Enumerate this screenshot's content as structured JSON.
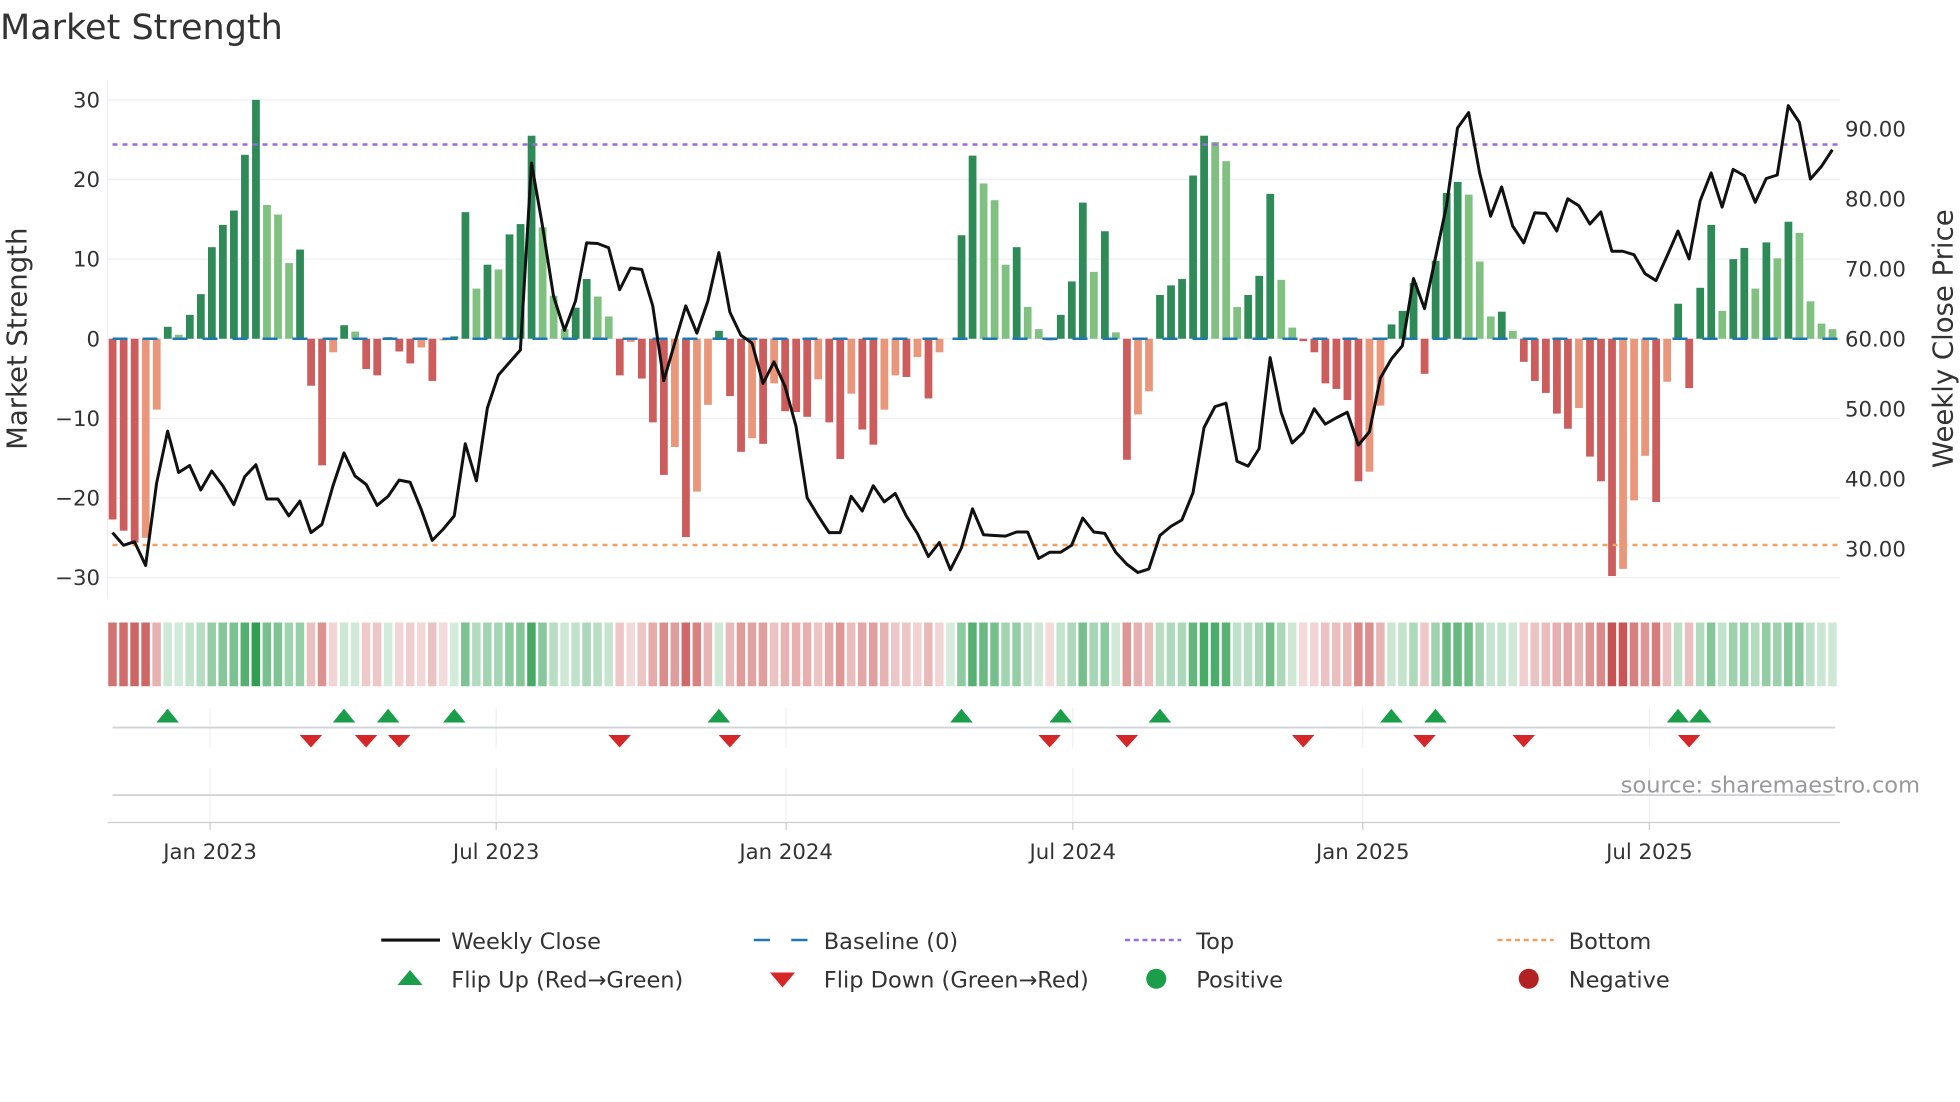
{
  "chart_data": {
    "type": "bar",
    "title": "Market Strength",
    "ylabel": "Market Strength",
    "y2label": "Weekly Close Price",
    "ylim": [
      -32,
      32
    ],
    "y2lim": [
      24,
      96
    ],
    "yticks": [
      -30,
      -20,
      -10,
      0,
      10,
      20,
      30
    ],
    "yticklabels": [
      "−30",
      "−20",
      "−10",
      "0",
      "10",
      "20",
      "30"
    ],
    "y2ticks": [
      30,
      40,
      50,
      60,
      70,
      80,
      90
    ],
    "y2ticklabels": [
      "30.00",
      "40.00",
      "50.00",
      "60.00",
      "70.00",
      "80.00",
      "90.00"
    ],
    "xticks": [
      {
        "week": 8.85,
        "label": "Jan 2023"
      },
      {
        "week": 34.8,
        "label": "Jul 2023"
      },
      {
        "week": 61.1,
        "label": "Jan 2024"
      },
      {
        "week": 87.1,
        "label": "Jul 2024"
      },
      {
        "week": 113.4,
        "label": "Jan 2025"
      },
      {
        "week": 139.4,
        "label": "Jul 2025"
      }
    ],
    "grid": true,
    "top_level": 24.4,
    "bottom_level": -25.9,
    "baseline": 0,
    "strength": [
      -22.7,
      -24.1,
      -25.6,
      -25,
      -8.9,
      1.5,
      0.5,
      3.0,
      5.6,
      11.5,
      14.3,
      16.1,
      23.1,
      30.0,
      16.8,
      15.6,
      9.5,
      11.2,
      -5.9,
      -15.9,
      -1.7,
      1.7,
      0.9,
      -3.8,
      -4.6,
      0.2,
      -1.6,
      -3.1,
      -1.1,
      -5.3,
      -0.2,
      0.3,
      15.9,
      6.3,
      9.3,
      8.7,
      13.1,
      14.4,
      25.5,
      14.0,
      5.4,
      1.2,
      3.9,
      7.5,
      5.3,
      2.8,
      -4.6,
      -0.4,
      -5.0,
      -10.5,
      -17.1,
      -13.6,
      -24.9,
      -19.2,
      -8.3,
      1.0,
      -7.2,
      -14.2,
      -12.5,
      -13.2,
      -5.6,
      -9.1,
      -9.2,
      -9.8,
      -5.1,
      -10.5,
      -15.1,
      -6.9,
      -11.4,
      -13.3,
      -8.9,
      -4.6,
      -4.8,
      -2.3,
      -7.5,
      -1.7,
      0,
      13.0,
      23.0,
      19.5,
      17.4,
      9.3,
      11.5,
      4.0,
      1.2,
      -0.2,
      3.0,
      7.2,
      17.1,
      8.4,
      13.5,
      0.8,
      -15.2,
      -9.5,
      -6.6,
      5.5,
      6.7,
      7.5,
      20.5,
      25.5,
      24.7,
      22.3,
      4.0,
      5.5,
      7.9,
      18.2,
      7.4,
      1.4,
      -0.3,
      -1.7,
      -5.6,
      -6.3,
      -7.7,
      -17.9,
      -16.7,
      -8.4,
      1.8,
      3.5,
      7.0,
      -4.4,
      9.8,
      18.3,
      19.7,
      18.1,
      9.7,
      2.8,
      3.4,
      1.0,
      -2.9,
      -5.3,
      -6.8,
      -9.4,
      -11.3,
      -8.7,
      -14.8,
      -17.9,
      -29.8,
      -28.9,
      -20.3,
      -14.7,
      -20.5,
      -5.4,
      4.4,
      -6.2,
      6.4,
      14.3,
      3.5,
      10.0,
      11.4,
      6.3,
      12.1,
      10.1,
      14.7,
      13.3,
      4.7,
      1.9,
      1.2
    ],
    "weekly_close": [
      32.3,
      30.5,
      31.0,
      27.6,
      39.4,
      46.8,
      40.9,
      41.9,
      38.4,
      41.1,
      39.0,
      36.3,
      40.3,
      42.0,
      37.1,
      37.1,
      34.7,
      36.8,
      32.3,
      33.5,
      39.0,
      43.7,
      40.4,
      39.2,
      36.2,
      37.5,
      39.8,
      39.5,
      35.6,
      31.2,
      32.8,
      34.7,
      45.0,
      39.7,
      50.1,
      54.8,
      56.6,
      58.4,
      85.1,
      76.1,
      66.1,
      61.2,
      65.4,
      73.7,
      73.6,
      73.0,
      67.0,
      70.1,
      69.9,
      64.7,
      54.0,
      59.4,
      64.7,
      60.8,
      65.4,
      72.3,
      63.8,
      60.5,
      59.4,
      53.6,
      56.7,
      53.2,
      47.5,
      37.3,
      34.7,
      32.3,
      32.3,
      37.5,
      35.4,
      39.0,
      36.7,
      37.9,
      34.7,
      32.2,
      28.9,
      30.9,
      27.0,
      30.1,
      35.7,
      32.0,
      31.9,
      31.8,
      32.4,
      32.4,
      28.6,
      29.5,
      29.5,
      30.5,
      34.4,
      32.4,
      32.2,
      29.5,
      27.8,
      26.6,
      27.1,
      31.9,
      33.2,
      34.1,
      38.0,
      47.3,
      50.3,
      50.8,
      42.5,
      41.8,
      44.3,
      57.3,
      49.5,
      45.1,
      46.6,
      50.0,
      47.8,
      48.7,
      49.5,
      44.8,
      46.7,
      54.4,
      57.1,
      59.0,
      68.6,
      64.3,
      71.6,
      79.0,
      90.1,
      92.3,
      83.7,
      77.5,
      81.7,
      76.1,
      73.7,
      78.0,
      77.9,
      75.4,
      80.0,
      79.0,
      76.4,
      78.1,
      72.5,
      72.5,
      72.0,
      69.3,
      68.3,
      71.8,
      75.4,
      71.4,
      79.7,
      83.7,
      78.8,
      84.2,
      83.3,
      79.5,
      82.9,
      83.4,
      93.3,
      90.9,
      82.8,
      84.6,
      87.0
    ],
    "flip_up_weeks": [
      5,
      21,
      25,
      31,
      55,
      77,
      86,
      95,
      116,
      120,
      142,
      144
    ],
    "flip_down_weeks": [
      18,
      23,
      26,
      46,
      56,
      85,
      92,
      108,
      119,
      128,
      143
    ],
    "legend": [
      {
        "key": "close",
        "label": "Weekly Close"
      },
      {
        "key": "baseline",
        "label": "Baseline (0)"
      },
      {
        "key": "top",
        "label": "Top"
      },
      {
        "key": "bottom",
        "label": "Bottom"
      },
      {
        "key": "flipup",
        "label": "Flip Up (Red→Green)"
      },
      {
        "key": "flipdown",
        "label": "Flip Down (Green→Red)"
      },
      {
        "key": "positive",
        "label": "Positive"
      },
      {
        "key": "negative",
        "label": "Negative"
      }
    ],
    "legend_placement": "bottom",
    "colors": {
      "pos_strong": "#2e8b57",
      "pos_weak": "#80c080",
      "neg_strong": "#cd5c5c",
      "neg_weak": "#e9967a",
      "close": "#111111",
      "baseline": "#1f77b4",
      "top": "#9b6bdc",
      "bottom": "#f0a060",
      "flip_up": "#1a9e4a",
      "flip_down": "#d62728",
      "positive": "#1a9e4a",
      "negative": "#b22222",
      "heat_pos": "#2e9e50",
      "heat_neg": "#c85050"
    }
  },
  "source": "source: sharemaestro.com"
}
